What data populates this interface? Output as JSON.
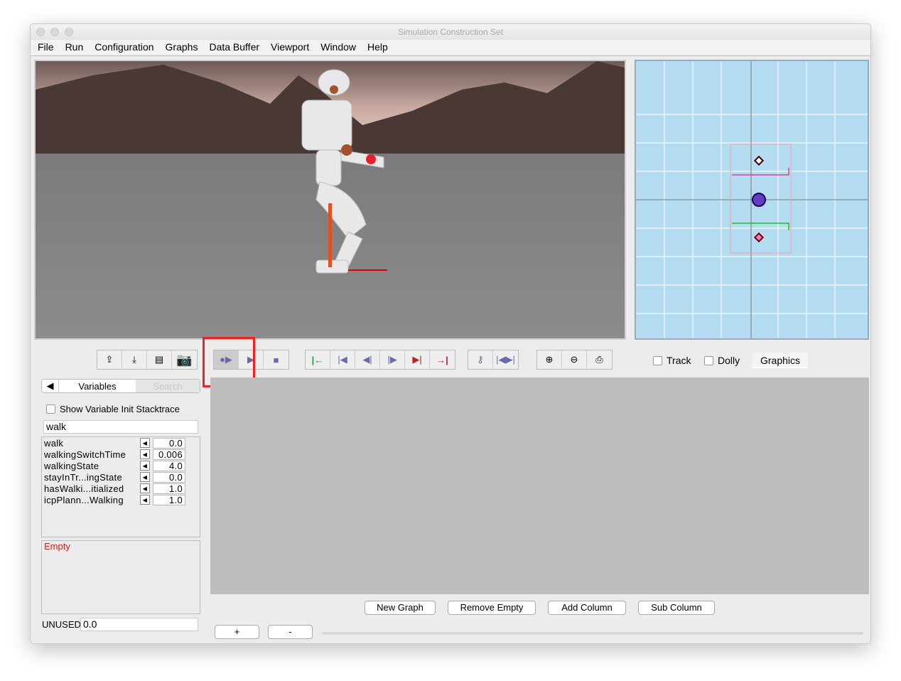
{
  "window": {
    "title": "Simulation Construction Set"
  },
  "menu": [
    "File",
    "Run",
    "Configuration",
    "Graphs",
    "Data Buffer",
    "Viewport",
    "Window",
    "Help"
  ],
  "toolbar": {
    "groups": [
      [
        "export-icon",
        "import-icon",
        "film-icon",
        "camera-icon"
      ],
      [
        "simulate-icon",
        "play-icon",
        "stop-icon"
      ],
      [
        "goto-in-point-icon",
        "step-to-start-icon",
        "step-back-icon",
        "step-forward-icon",
        "step-to-end-icon",
        "goto-out-point-icon"
      ],
      [
        "key-icon",
        "toggle-keypoint-icon"
      ],
      [
        "zoom-in-icon",
        "zoom-out-icon",
        "print-icon"
      ]
    ],
    "highlight_color": "#ee2222",
    "track_label": "Track",
    "dolly_label": "Dolly",
    "graphics_label": "Graphics"
  },
  "left_panel": {
    "tab_variables": "Variables",
    "tab_search": "Search",
    "show_stacktrace_label": "Show Variable Init Stacktrace",
    "search_value": "walk",
    "variables": [
      {
        "name": "walk",
        "value": "0.0"
      },
      {
        "name": "walkingSwitchTime",
        "value": "0.006"
      },
      {
        "name": "walkingState",
        "value": "4.0"
      },
      {
        "name": "stayInTr...ingState",
        "value": "0.0"
      },
      {
        "name": "hasWalki...itialized",
        "value": "1.0"
      },
      {
        "name": "icpPlann...Walking",
        "value": "1.0"
      }
    ],
    "empty_label": "Empty",
    "unused_label": "UNUSED",
    "unused_value": "0.0"
  },
  "graph_buttons": {
    "new_graph": "New Graph",
    "remove_empty": "Remove Empty",
    "add_column": "Add Column",
    "sub_column": "Sub Column",
    "plus": "+",
    "minus": "-"
  }
}
